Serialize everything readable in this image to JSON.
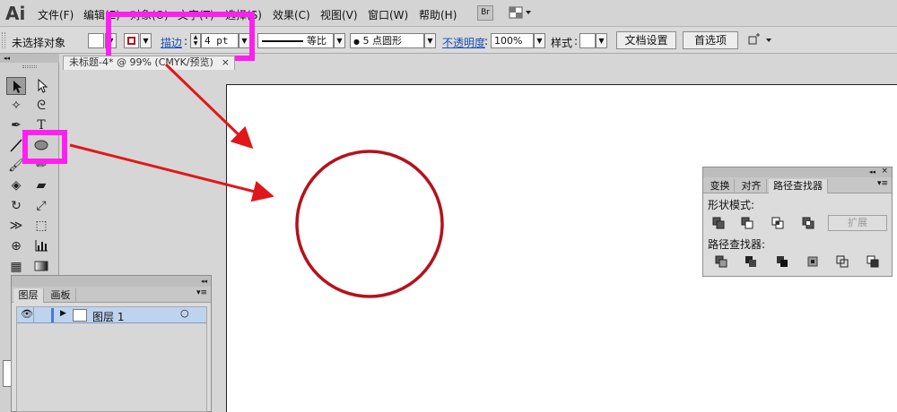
{
  "app": {
    "logo": "Ai"
  },
  "menu": [
    "文件(F)",
    "编辑(E)",
    "对象(O)",
    "文字(T)",
    "选择(S)",
    "效果(C)",
    "视图(V)",
    "窗口(W)",
    "帮助(H)"
  ],
  "menubar_buttons": {
    "bridge": "Br"
  },
  "control": {
    "selection_status": "未选择对象",
    "stroke_label": "描边",
    "stroke_weight": "4 pt",
    "stroke_profile": "等比",
    "brush": "5 点圆形",
    "opacity_label": "不透明度",
    "opacity": "100%",
    "style_label": "样式",
    "doc_setup": "文档设置",
    "preferences": "首选项"
  },
  "document": {
    "tab": "未标题-4* @ 99% (CMYK/预览)"
  },
  "layers_panel": {
    "tabs": [
      "图层",
      "画板"
    ],
    "rows": [
      {
        "name": "图层 1"
      }
    ]
  },
  "pathfinder_panel": {
    "tabs": [
      "变换",
      "对齐",
      "路径查找器"
    ],
    "shape_modes_label": "形状模式",
    "expand": "扩展",
    "pathfinders_label": "路径查找器"
  },
  "colors": {
    "stroke": "#b5121b",
    "highlight": "#ff1ff0",
    "arrow": "#e0171a"
  }
}
